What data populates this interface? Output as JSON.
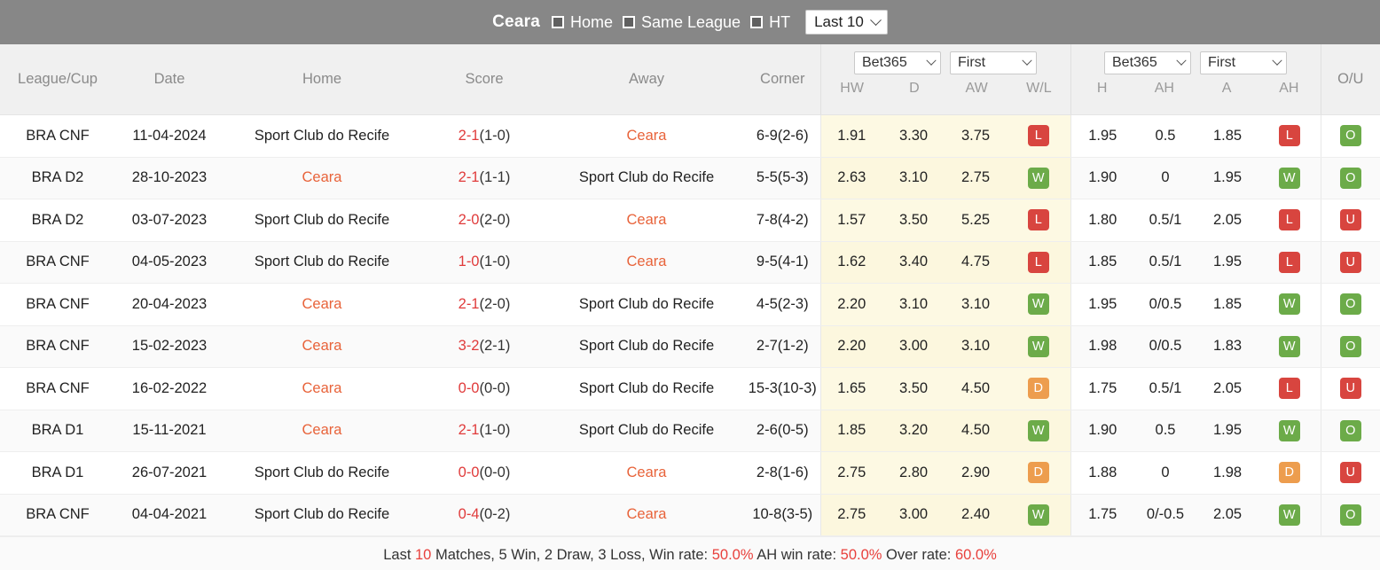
{
  "toolbar": {
    "team": "Ceara",
    "checkboxes": [
      {
        "label": "Home",
        "checked": true
      },
      {
        "label": "Same League",
        "checked": true
      },
      {
        "label": "HT",
        "checked": true
      }
    ],
    "range_select": {
      "value": "Last 10",
      "icon": "chevron-down-icon"
    }
  },
  "table": {
    "headers": {
      "league": "League/Cup",
      "date": "Date",
      "home": "Home",
      "score": "Score",
      "away": "Away",
      "corner": "Corner",
      "ou": "O/U"
    },
    "odds_group_1x2": {
      "bookmaker": "Bet365",
      "phase": "First",
      "cols": [
        "HW",
        "D",
        "AW",
        "W/L"
      ]
    },
    "odds_group_ah": {
      "bookmaker": "Bet365",
      "phase": "First",
      "cols": [
        "H",
        "AH",
        "A",
        "AH"
      ]
    },
    "rows": [
      {
        "league": "BRA CNF",
        "date": "11-04-2024",
        "home": "Sport Club do Recife",
        "home_hl": false,
        "score": "2-1",
        "score_ht": "(1-0)",
        "away": "Ceara",
        "away_hl": true,
        "corner": "6-9(2-6)",
        "hw": "1.91",
        "d": "3.30",
        "aw": "3.75",
        "wl": "L",
        "h": "1.95",
        "ah1": "0.5",
        "a": "1.85",
        "ah2": "L",
        "ou": "O"
      },
      {
        "league": "BRA D2",
        "date": "28-10-2023",
        "home": "Ceara",
        "home_hl": true,
        "score": "2-1",
        "score_ht": "(1-1)",
        "away": "Sport Club do Recife",
        "away_hl": false,
        "corner": "5-5(5-3)",
        "hw": "2.63",
        "d": "3.10",
        "aw": "2.75",
        "wl": "W",
        "h": "1.90",
        "ah1": "0",
        "a": "1.95",
        "ah2": "W",
        "ou": "O"
      },
      {
        "league": "BRA D2",
        "date": "03-07-2023",
        "home": "Sport Club do Recife",
        "home_hl": false,
        "score": "2-0",
        "score_ht": "(2-0)",
        "away": "Ceara",
        "away_hl": true,
        "corner": "7-8(4-2)",
        "hw": "1.57",
        "d": "3.50",
        "aw": "5.25",
        "wl": "L",
        "h": "1.80",
        "ah1": "0.5/1",
        "a": "2.05",
        "ah2": "L",
        "ou": "U"
      },
      {
        "league": "BRA CNF",
        "date": "04-05-2023",
        "home": "Sport Club do Recife",
        "home_hl": false,
        "score": "1-0",
        "score_ht": "(1-0)",
        "away": "Ceara",
        "away_hl": true,
        "corner": "9-5(4-1)",
        "hw": "1.62",
        "d": "3.40",
        "aw": "4.75",
        "wl": "L",
        "h": "1.85",
        "ah1": "0.5/1",
        "a": "1.95",
        "ah2": "L",
        "ou": "U"
      },
      {
        "league": "BRA CNF",
        "date": "20-04-2023",
        "home": "Ceara",
        "home_hl": true,
        "score": "2-1",
        "score_ht": "(2-0)",
        "away": "Sport Club do Recife",
        "away_hl": false,
        "corner": "4-5(2-3)",
        "hw": "2.20",
        "d": "3.10",
        "aw": "3.10",
        "wl": "W",
        "h": "1.95",
        "ah1": "0/0.5",
        "a": "1.85",
        "ah2": "W",
        "ou": "O"
      },
      {
        "league": "BRA CNF",
        "date": "15-02-2023",
        "home": "Ceara",
        "home_hl": true,
        "score": "3-2",
        "score_ht": "(2-1)",
        "away": "Sport Club do Recife",
        "away_hl": false,
        "corner": "2-7(1-2)",
        "hw": "2.20",
        "d": "3.00",
        "aw": "3.10",
        "wl": "W",
        "h": "1.98",
        "ah1": "0/0.5",
        "a": "1.83",
        "ah2": "W",
        "ou": "O"
      },
      {
        "league": "BRA CNF",
        "date": "16-02-2022",
        "home": "Ceara",
        "home_hl": true,
        "score": "0-0",
        "score_ht": "(0-0)",
        "away": "Sport Club do Recife",
        "away_hl": false,
        "corner": "15-3(10-3)",
        "hw": "1.65",
        "d": "3.50",
        "aw": "4.50",
        "wl": "D",
        "h": "1.75",
        "ah1": "0.5/1",
        "a": "2.05",
        "ah2": "L",
        "ou": "U"
      },
      {
        "league": "BRA D1",
        "date": "15-11-2021",
        "home": "Ceara",
        "home_hl": true,
        "score": "2-1",
        "score_ht": "(1-0)",
        "away": "Sport Club do Recife",
        "away_hl": false,
        "corner": "2-6(0-5)",
        "hw": "1.85",
        "d": "3.20",
        "aw": "4.50",
        "wl": "W",
        "h": "1.90",
        "ah1": "0.5",
        "a": "1.95",
        "ah2": "W",
        "ou": "O"
      },
      {
        "league": "BRA D1",
        "date": "26-07-2021",
        "home": "Sport Club do Recife",
        "home_hl": false,
        "score": "0-0",
        "score_ht": "(0-0)",
        "away": "Ceara",
        "away_hl": true,
        "corner": "2-8(1-6)",
        "hw": "2.75",
        "d": "2.80",
        "aw": "2.90",
        "wl": "D",
        "h": "1.88",
        "ah1": "0",
        "a": "1.98",
        "ah2": "D",
        "ou": "U"
      },
      {
        "league": "BRA CNF",
        "date": "04-04-2021",
        "home": "Sport Club do Recife",
        "home_hl": false,
        "score": "0-4",
        "score_ht": "(0-2)",
        "away": "Ceara",
        "away_hl": true,
        "corner": "10-8(3-5)",
        "hw": "2.75",
        "d": "3.00",
        "aw": "2.40",
        "wl": "W",
        "h": "1.75",
        "ah1": "0/-0.5",
        "a": "2.05",
        "ah2": "W",
        "ou": "O"
      }
    ]
  },
  "footer": {
    "prefix": "Last ",
    "count": "10",
    "mid": " Matches, 5 Win, 2 Draw, 3 Loss, Win rate: ",
    "win_rate": "50.0%",
    "ah_label": " AH win rate: ",
    "ah_rate": "50.0%",
    "over_label": " Over rate: ",
    "over_rate": "60.0%"
  },
  "colors": {
    "toolbar_bg": "#878787",
    "accent_team": "#e8633a",
    "score_red": "#e03b3b",
    "win_green": "#6cab49",
    "loss_red": "#d8453f",
    "draw_orange": "#ed9d4e",
    "odds_highlight_bg": "#fdf9e3"
  }
}
